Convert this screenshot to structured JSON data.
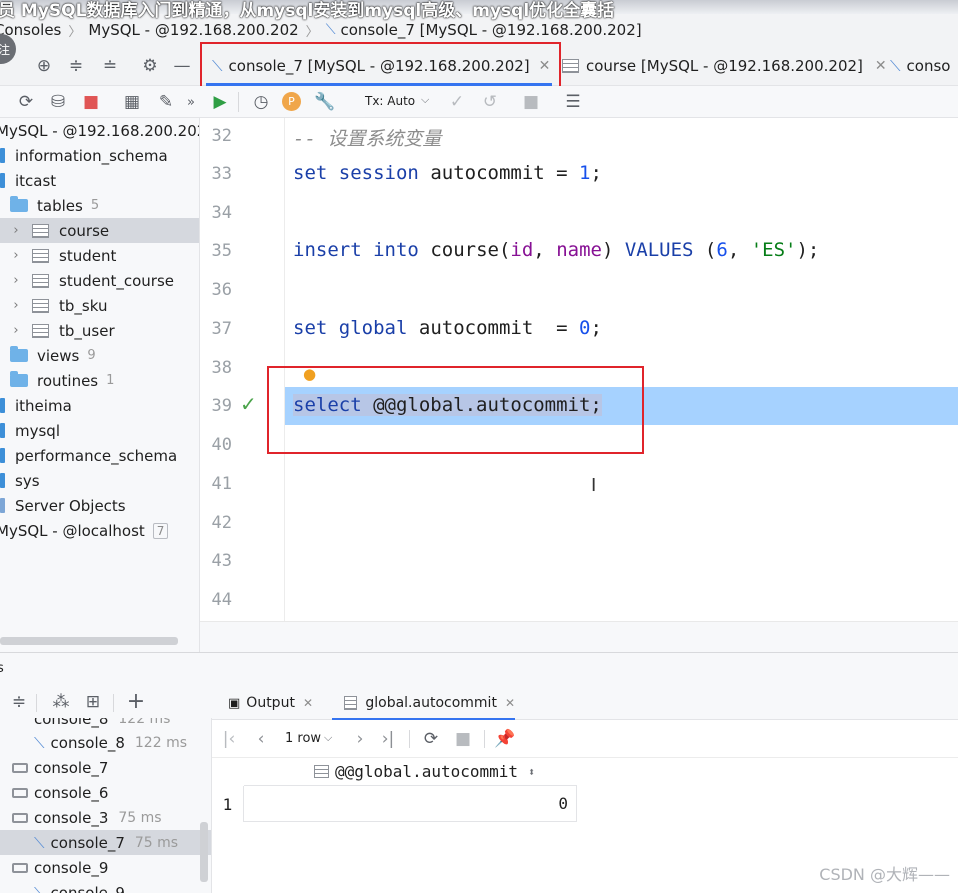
{
  "video_title": "员 MySQL数据库入门到精通，从mysql安装到mysql高级、mysql优化全囊括",
  "breadcrumb": [
    "Consoles",
    "MySQL - @192.168.200.202",
    "console_7 [MySQL - @192.168.200.202]"
  ],
  "left_badge": "注",
  "tabs": [
    {
      "label": "console_7 [MySQL - @192.168.200.202]",
      "active": true
    },
    {
      "label": "course [MySQL - @192.168.200.202]",
      "active": false
    },
    {
      "label": "conso",
      "active": false
    }
  ],
  "editor_toolbar": {
    "tx_mode": "Tx: Auto"
  },
  "tree": {
    "root": "MySQL - @192.168.200.202",
    "items": [
      {
        "label": "information_schema",
        "type": "schema"
      },
      {
        "label": "itcast",
        "type": "schema"
      },
      {
        "label": "tables",
        "type": "folder",
        "count": "5"
      },
      {
        "label": "course",
        "type": "table",
        "selected": true
      },
      {
        "label": "student",
        "type": "table"
      },
      {
        "label": "student_course",
        "type": "table"
      },
      {
        "label": "tb_sku",
        "type": "table"
      },
      {
        "label": "tb_user",
        "type": "table"
      },
      {
        "label": "views",
        "type": "folder",
        "count": "9"
      },
      {
        "label": "routines",
        "type": "folder",
        "count": "1"
      },
      {
        "label": "itheima",
        "type": "schema"
      },
      {
        "label": "mysql",
        "type": "schema"
      },
      {
        "label": "performance_schema",
        "type": "schema"
      },
      {
        "label": "sys",
        "type": "schema"
      },
      {
        "label": "Server Objects",
        "type": "server"
      }
    ],
    "localhost": {
      "label": "MySQL - @localhost",
      "count": "7"
    }
  },
  "editor": {
    "line_numbers": [
      "32",
      "33",
      "34",
      "35",
      "36",
      "37",
      "38",
      "39",
      "40",
      "41",
      "42",
      "43",
      "44"
    ],
    "comment": "-- 设置系统变量",
    "line33": {
      "kw1": "set",
      "kw2": "session",
      "ident": "autocommit",
      "eq": " = ",
      "val": "1",
      "end": ";"
    },
    "line35": {
      "kw1": "insert",
      "kw2": "into",
      "table": "course",
      "col1": "id",
      "col2": "name",
      "kw3": "VALUES",
      "num": "6",
      "str": "'ES'"
    },
    "line37": {
      "kw1": "set",
      "kw2": "global",
      "ident": "autocommit",
      "eq": "  = ",
      "val": "0",
      "end": ";"
    },
    "line39": {
      "kw1": "select",
      "rest": " @@global.autocommit;"
    }
  },
  "services": {
    "items": [
      {
        "label": "console_8",
        "time": "122 ms",
        "indent": true
      },
      {
        "label": "console_7",
        "time": "",
        "indent": false
      },
      {
        "label": "console_6",
        "time": "",
        "indent": false
      },
      {
        "label": "console_3",
        "time": "75 ms",
        "indent": false
      },
      {
        "label": "console_7",
        "time": "75 ms",
        "indent": true,
        "selected": true
      },
      {
        "label": "console_9",
        "time": "",
        "indent": false
      },
      {
        "label": "console_9",
        "time": "",
        "indent": true
      }
    ],
    "partial_top": {
      "label": "console_8",
      "time": "122 ms"
    }
  },
  "result": {
    "tabs": [
      {
        "label": "Output"
      },
      {
        "label": "global.autocommit"
      }
    ],
    "rows_label": "1 row",
    "column": "@@global.autocommit",
    "row_numbers": [
      "1"
    ],
    "values": [
      "0"
    ]
  },
  "watermark": "CSDN @大辉——",
  "accent_color": "#3574f0",
  "highlight_color": "#a6d2ff",
  "annotation_color": "#e0242b"
}
